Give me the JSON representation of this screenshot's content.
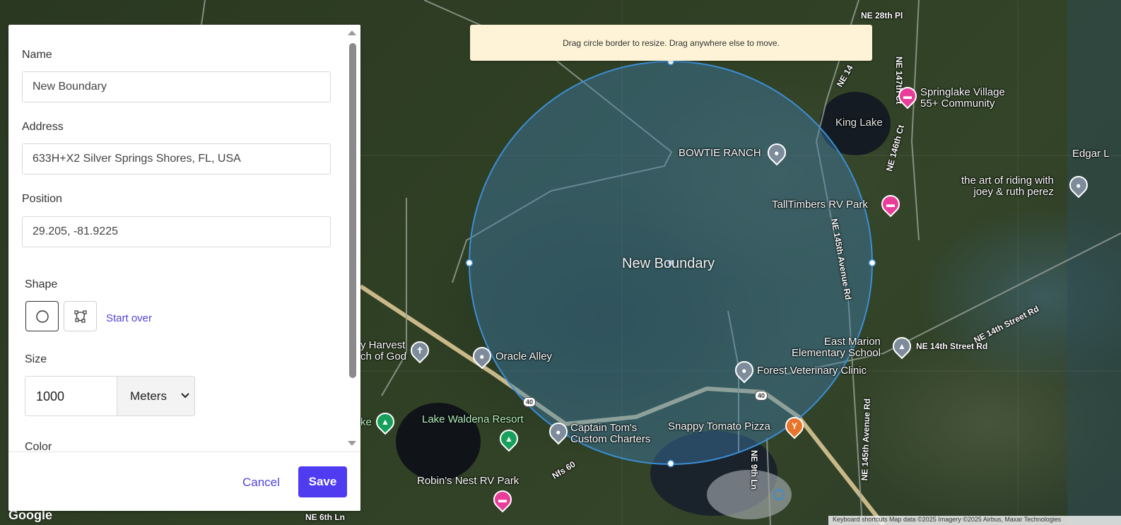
{
  "banner": {
    "text": "Drag circle border to resize. Drag anywhere else to move."
  },
  "form": {
    "name_label": "Name",
    "name_value": "New Boundary",
    "address_label": "Address",
    "address_value": "633H+X2 Silver Springs Shores, FL, USA",
    "position_label": "Position",
    "position_value": "29.205, -81.9225",
    "shape_label": "Shape",
    "start_over": "Start over",
    "size_label": "Size",
    "size_value": "1000",
    "size_unit": "Meters",
    "color_label": "Color"
  },
  "footer": {
    "cancel": "Cancel",
    "save": "Save"
  },
  "map": {
    "circle_label": "New Boundary",
    "places": {
      "bowtie": "BOWTIE RANCH",
      "springlake": "Springlake Village\n55+ Community",
      "king_lake": "King Lake",
      "edgar": "Edgar L",
      "art_riding": "the art of riding with\njoey & ruth perez",
      "talltimbers": "TallTimbers RV Park",
      "east_marion": "East Marion\nElementary School",
      "ne14_label": "NE 14th Street Rd",
      "forest_vet": "Forest Veterinary Clinic",
      "oracle": "Oracle Alley",
      "harvest": "y Harvest\nch of God",
      "captain": "Captain Tom's\nCustom Charters",
      "snappy": "Snappy Tomato Pizza",
      "lake_waldena": "Lake Waldena Resort",
      "ke": "ke",
      "robins": "Robin's Nest RV Park"
    },
    "roads": {
      "ne28": "NE 28th Pl",
      "ne147": "NE 147th Ct",
      "ne146": "NE 146th Ct",
      "ne145a": "NE 145th Avenue Rd",
      "ne145b": "NE 145th Avenue Rd",
      "ne14_street": "NE 14th Street Rd",
      "ne14_top": "NE 14",
      "ne14_far": "NE 14th Street Rd",
      "nfs60": "Nfs 60",
      "ne9": "NE 9th Ln",
      "ne6": "NE 6th Ln",
      "rt40a": "40",
      "rt40b": "40"
    },
    "logo": "Google",
    "attribution": "Keyboard shortcuts    Map data ©2025 Imagery ©2025 Airbus, Maxar Technologies"
  },
  "colors": {
    "accent": "#4f3cf0",
    "link": "#5244d8",
    "circle_stroke": "#3b8fd6",
    "circle_fill": "#3e7fb0"
  }
}
